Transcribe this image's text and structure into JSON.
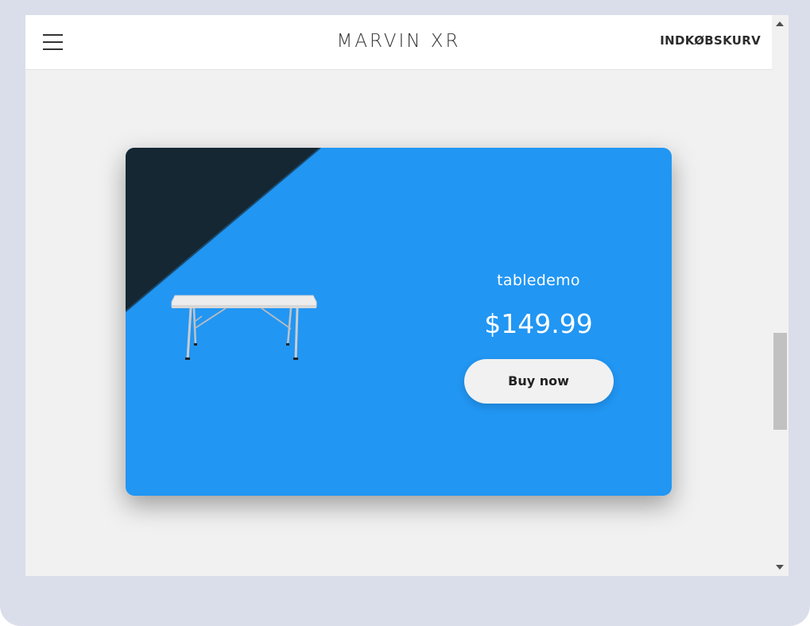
{
  "header": {
    "menu_icon": "hamburger-menu-icon",
    "brand": "MARVIN XR",
    "cart_label": "INDKØBSKURV"
  },
  "product": {
    "name": "tabledemo",
    "price": "$149.99",
    "buy_label": "Buy now",
    "image": "folding-table"
  },
  "colors": {
    "card_background": "#2196f3",
    "card_corner": "#142733",
    "page_background": "#f1f1f1",
    "frame": "#dadeea",
    "button_background": "#f1f1f1"
  },
  "scrollbar": {
    "up_icon": "scroll-up-arrow-icon",
    "down_icon": "scroll-down-arrow-icon"
  }
}
